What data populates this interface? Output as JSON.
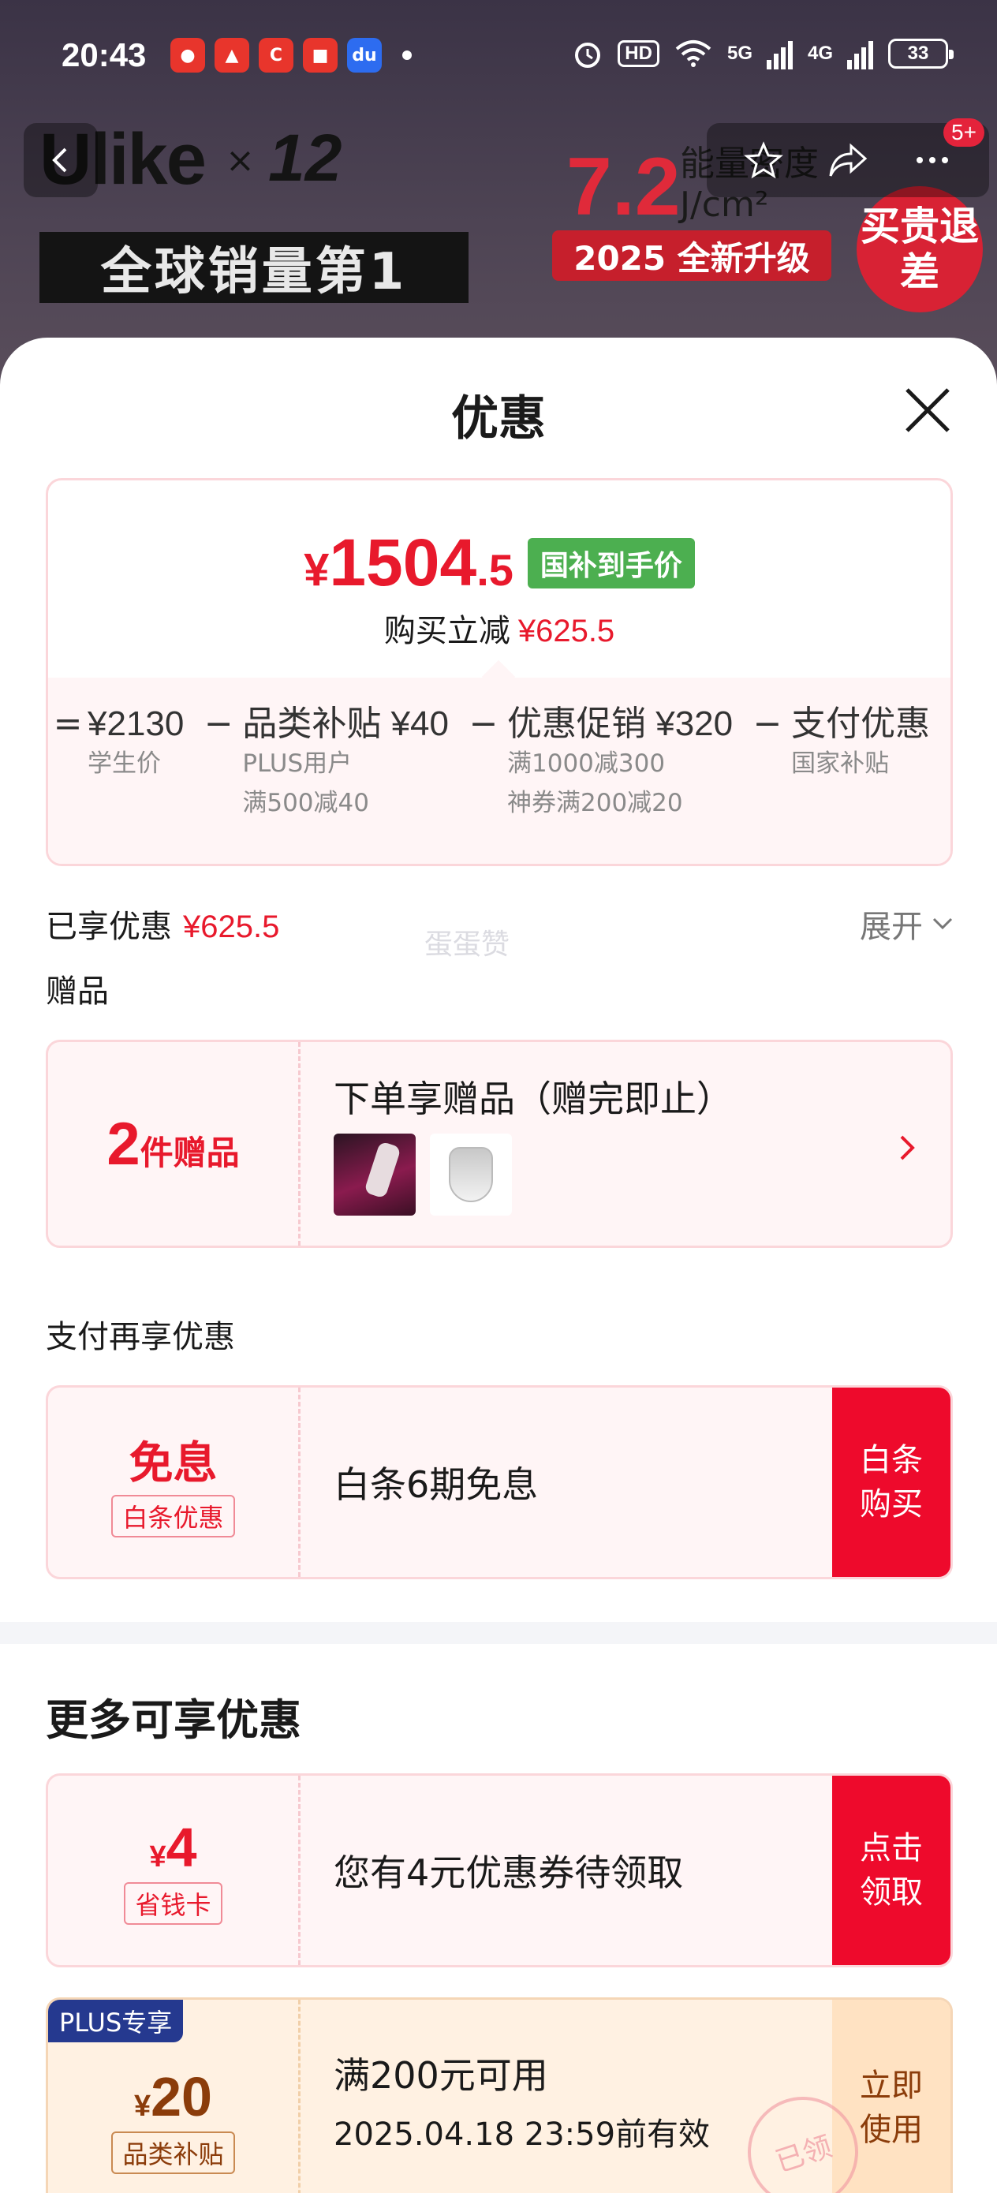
{
  "status_bar": {
    "time": "20:43",
    "network_5g": "5G",
    "network_4g": "4G",
    "hd": "HD",
    "battery": "33"
  },
  "product_header": {
    "brand": "Ulike",
    "brand_x": "×",
    "brand_years": "12",
    "slogan": "全球销量第1",
    "energy_value": "7.2",
    "energy_label": "能量密度",
    "energy_unit": "J/cm²",
    "upgrade": "2025 全新升级",
    "seal": "买贵退差",
    "nav_badge": "5+"
  },
  "sheet": {
    "title": "优惠",
    "price": {
      "currency": "¥",
      "integer": "1504",
      "decimal": ".5",
      "tag": "国补到手价",
      "sub_label": "购买立减",
      "sub_value": "¥625.5"
    },
    "breakdown": [
      {
        "op": "=",
        "value": "¥2130",
        "notes": [
          "学生价"
        ]
      },
      {
        "op": "−",
        "value": "品类补贴 ¥40",
        "notes": [
          "PLUS用户",
          "满500减40"
        ]
      },
      {
        "op": "−",
        "value": "优惠促销 ¥320",
        "notes": [
          "满1000减300",
          "神券满200减20"
        ]
      },
      {
        "op": "−",
        "value": "支付优惠",
        "notes": [
          "国家补贴"
        ]
      }
    ],
    "enjoyed": {
      "label": "已享优惠",
      "value": "¥625.5",
      "expand": "展开"
    },
    "gifts": {
      "section": "赠品",
      "count": "2",
      "count_unit": "件赠品",
      "title": "下单享赠品（赠完即止）",
      "watermark": "蛋蛋赞"
    },
    "payment": {
      "section": "支付再享优惠",
      "badge_top": "免息",
      "badge_bottom": "白条优惠",
      "text": "白条6期免息",
      "action": "白条购买"
    },
    "more": {
      "title": "更多可享优惠",
      "coupon": {
        "currency": "¥",
        "amount": "4",
        "label": "省钱卡",
        "text": "您有4元优惠券待领取",
        "action": "点击领取"
      },
      "plus_coupon": {
        "tag": "PLUS专享",
        "currency": "¥",
        "amount": "20",
        "label": "品类补贴",
        "line1": "满200元可用",
        "line2": "2025.04.18 23:59前有效",
        "action": "立即使用",
        "stamp": "已领"
      }
    }
  },
  "colors": {
    "accent_red": "#e8192c",
    "action_red": "#ee0a2c",
    "tag_green": "#4caf50",
    "plus_blue": "#25398f",
    "plus_brown": "#8b3c0a"
  }
}
